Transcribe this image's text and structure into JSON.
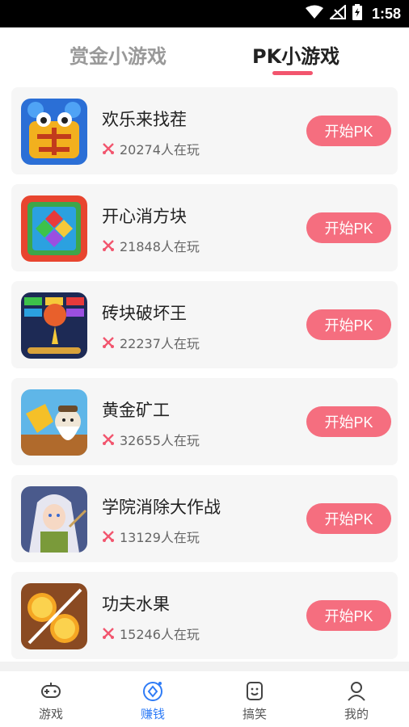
{
  "status_bar": {
    "time": "1:58",
    "icons": [
      "wifi-icon",
      "no-signal-icon",
      "battery-charging-icon"
    ]
  },
  "tabs": [
    {
      "label": "赏金小游戏",
      "active": false
    },
    {
      "label": "PK小游戏",
      "active": true
    }
  ],
  "games": [
    {
      "name": "欢乐来找茬",
      "players": "20274人在玩",
      "button": "开始PK",
      "icon": "find-difference-game-icon"
    },
    {
      "name": "开心消方块",
      "players": "21848人在玩",
      "button": "开始PK",
      "icon": "gem-blocks-game-icon"
    },
    {
      "name": "砖块破坏王",
      "players": "22237人在玩",
      "button": "开始PK",
      "icon": "brick-breaker-game-icon"
    },
    {
      "name": "黄金矿工",
      "players": "32655人在玩",
      "button": "开始PK",
      "icon": "gold-miner-game-icon"
    },
    {
      "name": "学院消除大作战",
      "players": "13129人在玩",
      "button": "开始PK",
      "icon": "academy-match-game-icon"
    },
    {
      "name": "功夫水果",
      "players": "15246人在玩",
      "button": "开始PK",
      "icon": "kungfu-fruit-game-icon"
    }
  ],
  "nav": [
    {
      "label": "游戏",
      "icon": "gamepad-icon",
      "active": false
    },
    {
      "label": "赚钱",
      "icon": "earn-coin-icon",
      "active": true
    },
    {
      "label": "搞笑",
      "icon": "funny-face-icon",
      "active": false
    },
    {
      "label": "我的",
      "icon": "profile-icon",
      "active": false
    }
  ],
  "colors": {
    "accent": "#f2556e",
    "button": "#f56e7f",
    "nav_active": "#2f7cf6"
  }
}
